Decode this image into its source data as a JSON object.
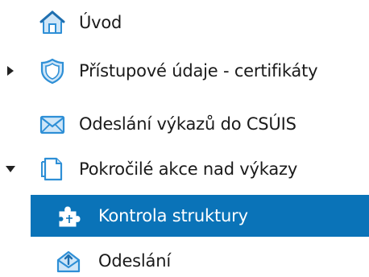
{
  "tree": {
    "items": [
      {
        "label": "Úvod",
        "icon": "home-icon"
      },
      {
        "label": "Přístupové údaje - certifikáty",
        "icon": "shield-icon",
        "expander": "collapsed"
      },
      {
        "label": "Odeslání výkazů do CSÚIS",
        "icon": "envelope-icon"
      },
      {
        "label": "Pokročilé akce nad výkazy",
        "icon": "document-icon",
        "expander": "expanded",
        "children": [
          {
            "label": "Kontrola struktury",
            "icon": "puzzle-icon",
            "selected": true
          },
          {
            "label": "Odeslání",
            "icon": "send-icon"
          }
        ]
      }
    ]
  },
  "colors": {
    "selection_bg": "#0a73b8",
    "icon_blue": "#2e8fd6",
    "text": "#1a1a1a"
  }
}
